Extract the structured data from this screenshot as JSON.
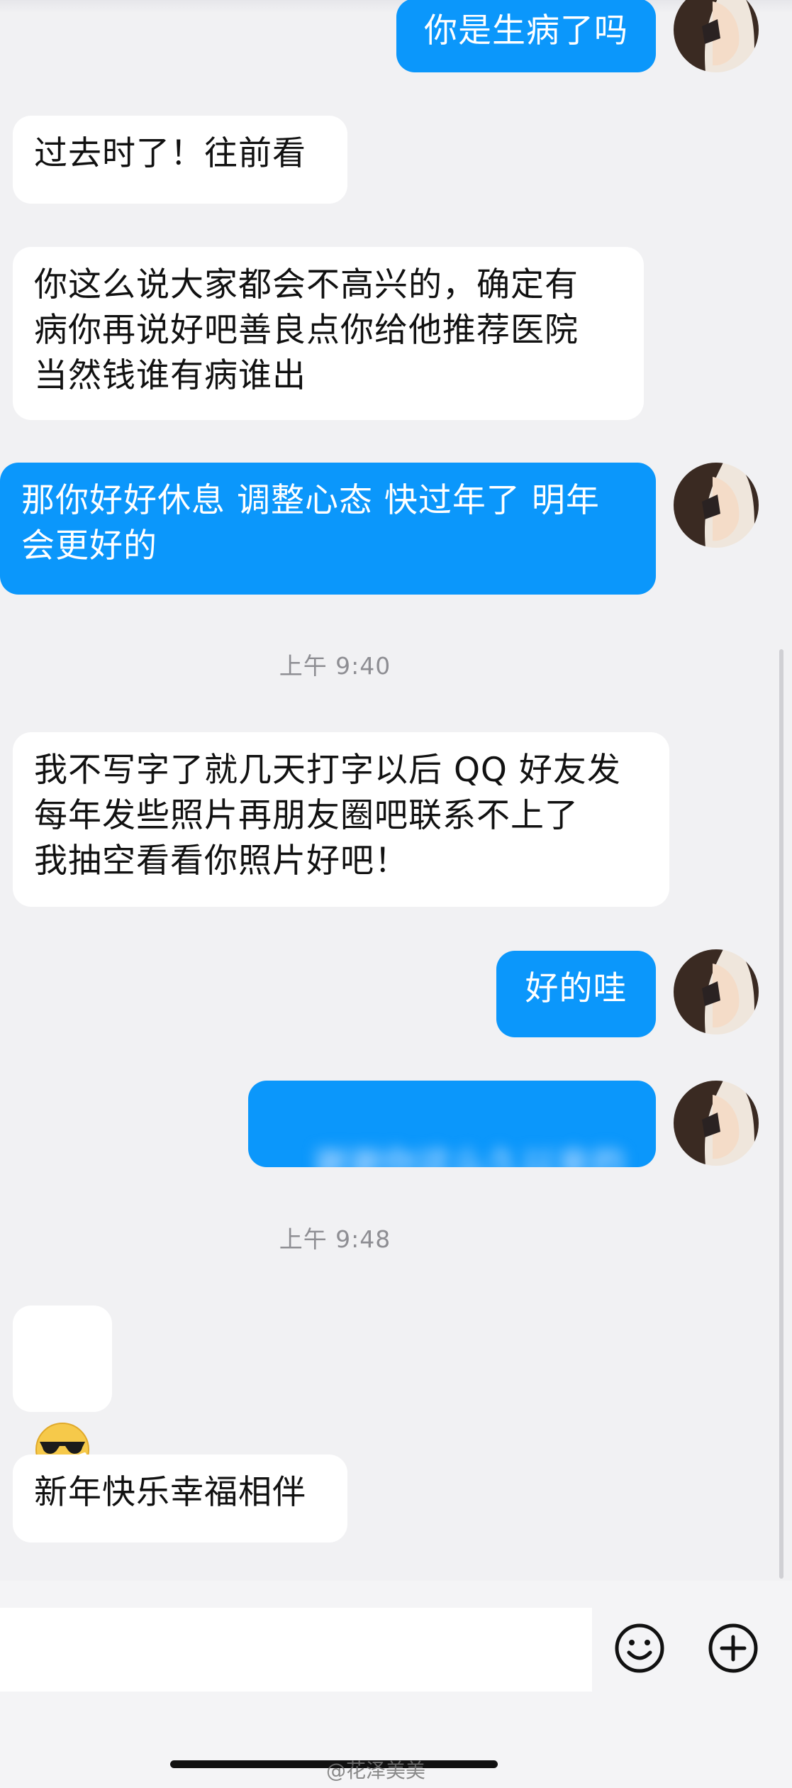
{
  "messages": {
    "m1": "你是生病了吗",
    "m2": "过去时了！往前看",
    "m3": "你这么说大家都会不高兴的，确定有\n病你再说好吧善良点你给他推荐医院\n当然钱谁有病谁出",
    "m4": "那你好好休息 调整心态 快过年了 明年\n会更好的",
    "t1": "上午 9:40",
    "m5": "我不写字了就几天打字以后 QQ 好友发\n每年发些照片再朋友圈吧联系不上了\n我抽空看看你照片好吧！",
    "m6": "好的哇",
    "m7_blurred": "谢谢你这么久以来的照顾",
    "t2": "上午 9:48",
    "m8_emoji": "😎",
    "m9": "新年快乐幸福相伴"
  },
  "watermark": "@花泽美美",
  "icons": {
    "emoji": "smiley-icon",
    "plus": "plus-circle-icon"
  },
  "colors": {
    "outgoing": "#0b97fb",
    "incoming": "#ffffff",
    "background": "#f1f1f3"
  }
}
